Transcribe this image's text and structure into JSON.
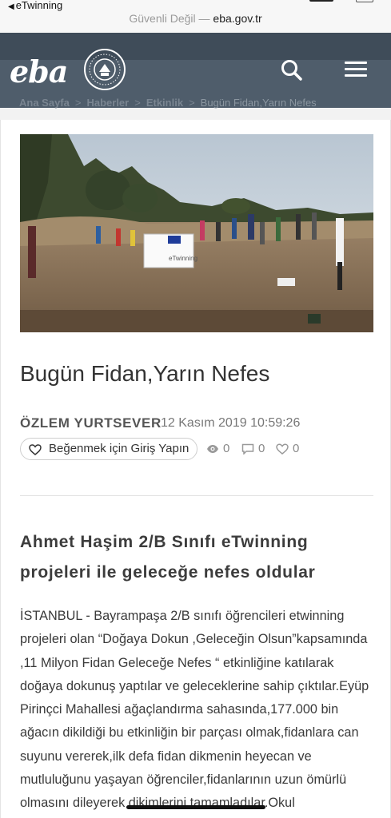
{
  "status_bar": {
    "back_app": "eTwinning"
  },
  "address_bar": {
    "warning": "Güvenli Değil —",
    "domain": "eba.gov.tr"
  },
  "header": {
    "logo": "eba",
    "breadcrumb": [
      "Ana Sayfa",
      "Haberler",
      "Etkinlik",
      "Bugün Fidan,Yarın Nefes"
    ],
    "breadcrumb_separator": ">"
  },
  "article": {
    "image_banner": "eTwinning",
    "title": "Bugün Fidan,Yarın Nefes",
    "author": "ÖZLEM YURTSEVER",
    "date": "12 Kasım 2019 10:59:26",
    "like_login_label": "Beğenmek için Giriş Yapın",
    "views": "0",
    "comments": "0",
    "likes": "0",
    "subheading": "Ahmet Haşim 2/B Sınıfı eTwinning projeleri ile geleceğe nefes oldular",
    "body": "İSTANBUL - Bayrampaşa 2/B sınıfı öğrencileri etwinning projeleri olan “Doğaya Dokun ,Geleceğin Olsun”kapsamında ,11 Milyon Fidan Geleceğe Nefes “ etkinliğine katılarak doğaya dokunuş yaptılar ve geleceklerine sahip çıktılar.Eyüp Pirinçci Mahallesi ağaçlandırma sahasında,177.000 bin ağacın dikildiği bu etkinliğin bir parçası olmak,fidanlara can suyunu vererek,ilk defa fidan dikmenin heyecan ve mutluluğunu yaşayan öğrenciler,fidanlarının uzun ömürlü olmasını dileyerek dikimlerini tamamladılar.Okul"
  },
  "colors": {
    "header_bg": "#4f5d6b",
    "header_strip": "#3f4c59",
    "accent_text": "#333333"
  }
}
